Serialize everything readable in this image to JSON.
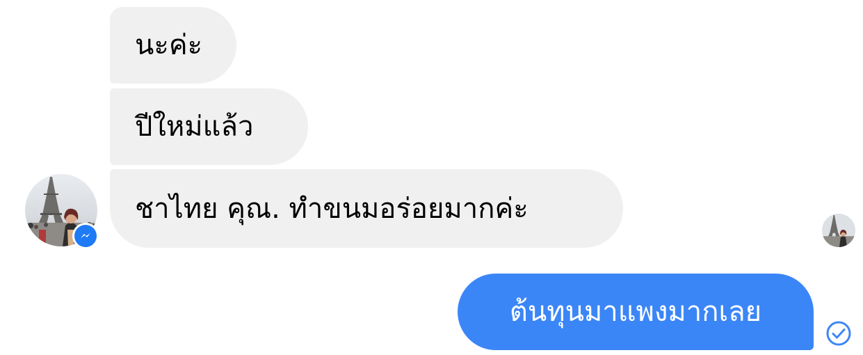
{
  "conversation": {
    "contact_avatar_icon": "contact-avatar-eiffel-tower-photo",
    "messenger_badge_icon": "messenger-bolt-icon",
    "incoming_messages": [
      {
        "text": "นะค่ะ"
      },
      {
        "text": "ปีใหม่แล้ว"
      },
      {
        "text": "ชาไทย คุณ. ทำขนมอร่อยมากค่ะ"
      }
    ],
    "outgoing_messages": [
      {
        "text": "ต้นทุนมาแพงมากเลย"
      }
    ],
    "read_receipt_icon": "seen-avatar-icon",
    "sent_status_icon": "sent-check-circle-icon"
  },
  "colors": {
    "incoming_bubble": "#f1f0f0",
    "outgoing_bubble": "#3b86f7",
    "messenger_blue": "#1e7af5",
    "status_check": "#3b86f7"
  }
}
